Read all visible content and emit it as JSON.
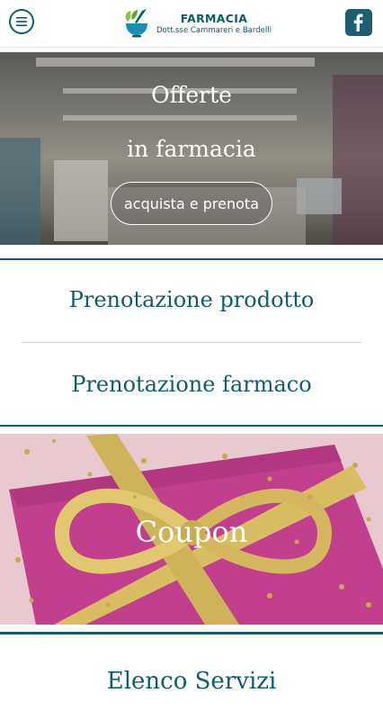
{
  "header": {
    "title": "FARMACIA",
    "subtitle": "Dott.sse Cammareri e Bardelli",
    "menu_icon": "menu-icon",
    "facebook_icon": "facebook-icon"
  },
  "hero": {
    "line1": "Offerte",
    "line2": "in farmacia",
    "button_label": "acquista e prenota"
  },
  "links": {
    "product": "Prenotazione prodotto",
    "drug": "Prenotazione farmaco"
  },
  "coupon": {
    "label": "Coupon"
  },
  "services": {
    "label": "Elenco Servizi"
  },
  "colors": {
    "accent": "#0d5d6b",
    "facebook": "#1d5f70",
    "gift_box": "#c23f8e",
    "ribbon": "#d8bd63"
  }
}
